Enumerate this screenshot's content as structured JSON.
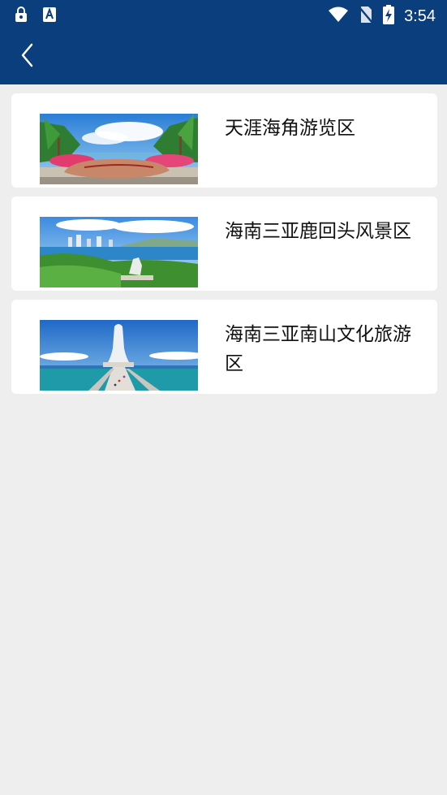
{
  "status_bar": {
    "time": "3:54",
    "icons": [
      "lock-icon",
      "a-badge-icon",
      "wifi-icon",
      "no-sim-icon",
      "battery-charging-icon"
    ]
  },
  "app_bar": {
    "back_icon": "chevron-left-icon",
    "color": "#0a3e7c"
  },
  "scenic_spots": [
    {
      "title": "天涯海角游览区",
      "thumbnail": "beach-rock-with-palms"
    },
    {
      "title": "海南三亚鹿回头风景区",
      "thumbnail": "bay-city-view-with-deer-statue"
    },
    {
      "title": "海南三亚南山文化旅游区",
      "thumbnail": "guanyin-statue-on-sea"
    }
  ]
}
